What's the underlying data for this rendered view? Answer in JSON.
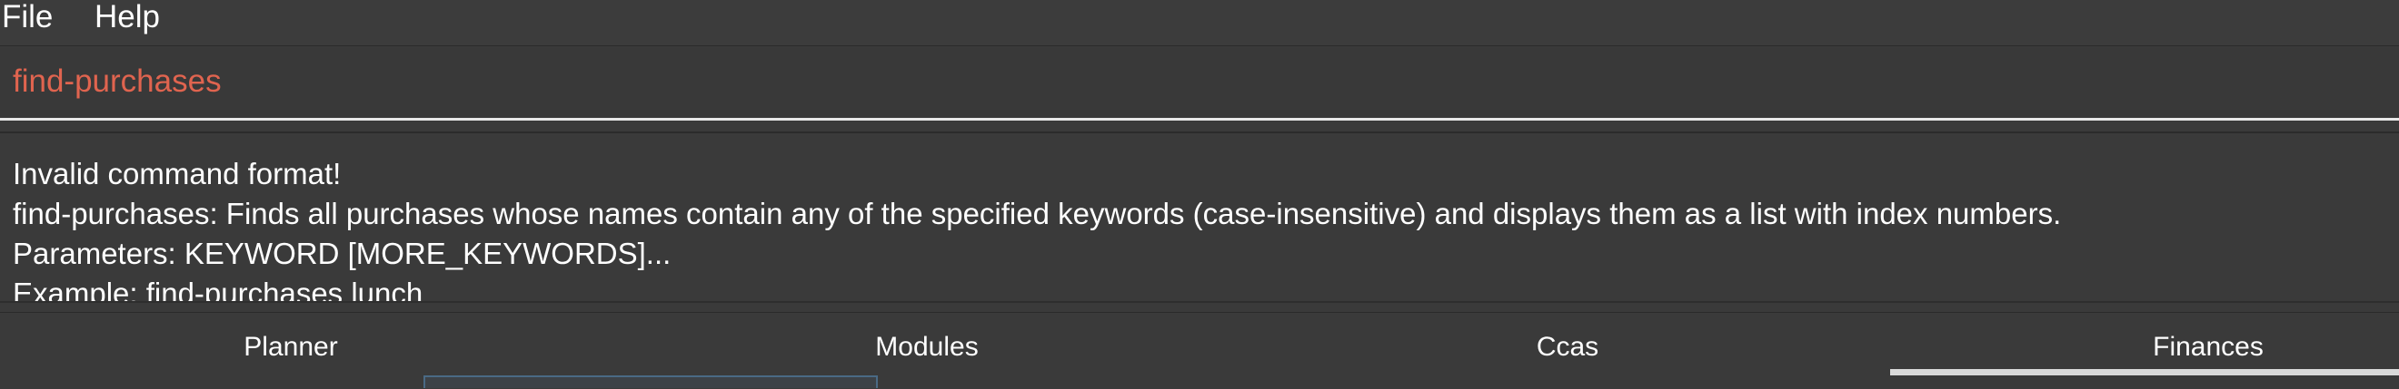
{
  "menu": {
    "file_label": "File",
    "help_label": "Help"
  },
  "command": {
    "value": "find-purchases",
    "text_color": "#e0644f"
  },
  "result": {
    "lines": [
      "Invalid command format!",
      "find-purchases: Finds all purchases whose names contain any of the specified keywords (case-insensitive) and displays them as a list with index numbers.",
      "Parameters: KEYWORD [MORE_KEYWORDS]...",
      "Example: find-purchases lunch"
    ]
  },
  "tabs": [
    {
      "label": "Planner",
      "selected": false
    },
    {
      "label": "Modules",
      "selected": false
    },
    {
      "label": "Ccas",
      "selected": false
    },
    {
      "label": "Finances",
      "selected": true
    }
  ],
  "colors": {
    "background": "#3a3a3a",
    "text": "#ffffff",
    "error_command": "#e0644f",
    "active_tab_indicator": "#d9d9d9"
  }
}
